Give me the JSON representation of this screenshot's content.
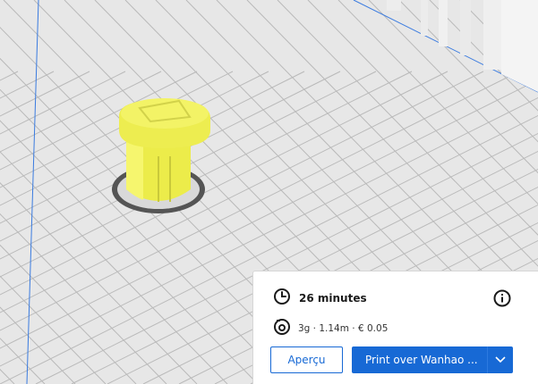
{
  "print_panel": {
    "time_label": "26 minutes",
    "material_label": "3g · 1.14m · € 0.05",
    "preview_button_label": "Aperçu",
    "print_button_label": "Print over Wanhao ...",
    "icons": {
      "time": "clock-icon",
      "info": "info-icon",
      "material": "spool-icon",
      "dropdown": "chevron-down-icon"
    }
  },
  "colors": {
    "accent": "#1769d5",
    "model": "#f2f25a",
    "build_plate": "#e6e6e6",
    "grid_line": "#b9b9b9"
  }
}
